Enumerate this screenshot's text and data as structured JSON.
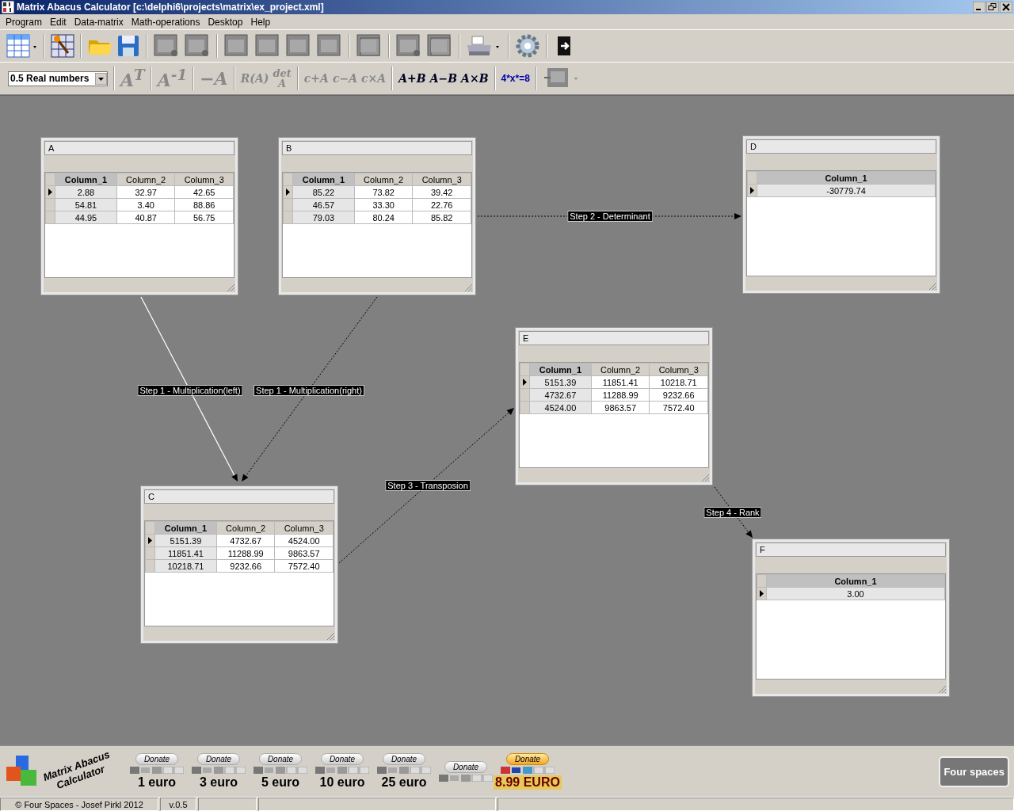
{
  "window": {
    "title": "Matrix Abacus Calculator [c:\\delphi6\\projects\\matrix\\ex_project.xml]"
  },
  "menu": [
    "Program",
    "Edit",
    "Data-matrix",
    "Math-operations",
    "Desktop",
    "Help"
  ],
  "precision_select": {
    "value": "0.5 Real numbers"
  },
  "operations": [
    {
      "label": "A$^{T}$",
      "kind": "big",
      "disabled": true
    },
    {
      "label": "A$^{-1}$",
      "kind": "big",
      "disabled": true
    },
    {
      "label": "−A",
      "kind": "big",
      "disabled": true
    },
    {
      "label": "R(A)",
      "kind": "small",
      "disabled": true
    },
    {
      "label": "det",
      "sub": "A",
      "kind": "stacked",
      "disabled": true
    },
    {
      "label": "c+A",
      "kind": "small",
      "disabled": true
    },
    {
      "label": "c−A",
      "kind": "small",
      "disabled": true
    },
    {
      "label": "c×A",
      "kind": "small",
      "disabled": true
    },
    {
      "label": "A+B",
      "kind": "small",
      "disabled": false
    },
    {
      "label": "A−B",
      "kind": "small",
      "disabled": false
    },
    {
      "label": "A×B",
      "kind": "small",
      "disabled": false
    },
    {
      "label": "4*x*=8",
      "kind": "equation",
      "disabled": false
    }
  ],
  "matrices": [
    {
      "name": "A",
      "columns": [
        {
          "label": "Column_1",
          "selected": true
        },
        {
          "label": "Column_2",
          "selected": false
        },
        {
          "label": "Column_3",
          "selected": false
        }
      ],
      "rows": [
        {
          "selected": true,
          "cells": [
            "2.88",
            "32.97",
            "42.65"
          ]
        },
        {
          "selected": false,
          "cells": [
            "54.81",
            "3.40",
            "88.86"
          ]
        },
        {
          "selected": false,
          "cells": [
            "44.95",
            "40.87",
            "56.75"
          ]
        }
      ]
    },
    {
      "name": "B",
      "columns": [
        {
          "label": "Column_1",
          "selected": true
        },
        {
          "label": "Column_2",
          "selected": false
        },
        {
          "label": "Column_3",
          "selected": false
        }
      ],
      "rows": [
        {
          "selected": true,
          "cells": [
            "85.22",
            "73.82",
            "39.42"
          ]
        },
        {
          "selected": false,
          "cells": [
            "46.57",
            "33.30",
            "22.76"
          ]
        },
        {
          "selected": false,
          "cells": [
            "79.03",
            "80.24",
            "85.82"
          ]
        }
      ]
    },
    {
      "name": "D",
      "columns": [
        {
          "label": "Column_1",
          "selected": true
        }
      ],
      "rows": [
        {
          "selected": true,
          "cells": [
            "-30779.74"
          ]
        }
      ]
    },
    {
      "name": "E",
      "columns": [
        {
          "label": "Column_1",
          "selected": true
        },
        {
          "label": "Column_2",
          "selected": false
        },
        {
          "label": "Column_3",
          "selected": false
        }
      ],
      "rows": [
        {
          "selected": true,
          "cells": [
            "5151.39",
            "11851.41",
            "10218.71"
          ]
        },
        {
          "selected": false,
          "cells": [
            "4732.67",
            "11288.99",
            "9232.66"
          ]
        },
        {
          "selected": false,
          "cells": [
            "4524.00",
            "9863.57",
            "7572.40"
          ]
        }
      ]
    },
    {
      "name": "C",
      "columns": [
        {
          "label": "Column_1",
          "selected": true
        },
        {
          "label": "Column_2",
          "selected": false
        },
        {
          "label": "Column_3",
          "selected": false
        }
      ],
      "rows": [
        {
          "selected": true,
          "cells": [
            "5151.39",
            "4732.67",
            "4524.00"
          ]
        },
        {
          "selected": false,
          "cells": [
            "11851.41",
            "11288.99",
            "9863.57"
          ]
        },
        {
          "selected": false,
          "cells": [
            "10218.71",
            "9232.66",
            "7572.40"
          ]
        }
      ]
    },
    {
      "name": "F",
      "columns": [
        {
          "label": "Column_1",
          "selected": true
        }
      ],
      "rows": [
        {
          "selected": true,
          "cells": [
            "3.00"
          ]
        }
      ]
    }
  ],
  "connectors": [
    {
      "label": "Step 2 - Determinant",
      "kind": "dotted"
    },
    {
      "label": "Step 1 - Multiplication(left)",
      "kind": "solid"
    },
    {
      "label": "Step 1 - Multiplication(right)",
      "kind": "dotted"
    },
    {
      "label": "Step 3 - Transposion",
      "kind": "dotted"
    },
    {
      "label": "Step 4 - Rank",
      "kind": "dotted"
    }
  ],
  "branding": {
    "logo_text": "Matrix Abacus Calculator",
    "company_logo": "Four spaces"
  },
  "donations": [
    {
      "button": "Donate",
      "amount": "1 euro",
      "highlighted": false
    },
    {
      "button": "Donate",
      "amount": "3 euro",
      "highlighted": false
    },
    {
      "button": "Donate",
      "amount": "5 euro",
      "highlighted": false
    },
    {
      "button": "Donate",
      "amount": "10 euro",
      "highlighted": false
    },
    {
      "button": "Donate",
      "amount": "25 euro",
      "highlighted": false
    },
    {
      "button": "Donate",
      "highlighted": false
    },
    {
      "button": "Donate",
      "amount": "8.99 EURO",
      "highlighted": true
    }
  ],
  "status_bar": [
    "© Four Spaces - Josef Pirkl 2012",
    "v.0.5"
  ]
}
